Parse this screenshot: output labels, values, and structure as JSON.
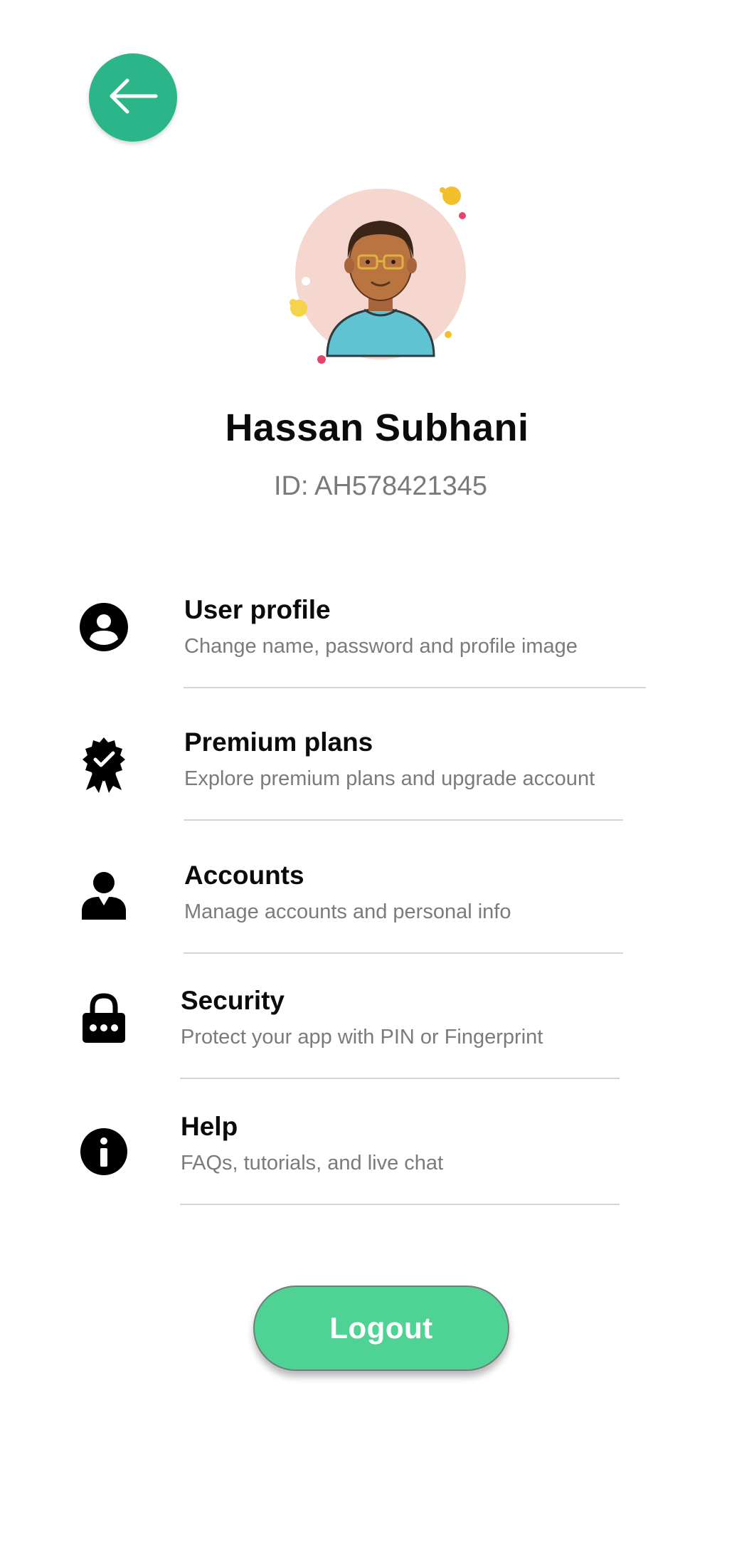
{
  "header": {
    "back_icon": "arrow-left-icon"
  },
  "profile": {
    "name": "Hassan Subhani",
    "id_text": "ID: AH578421345",
    "avatar_icon": "avatar-illustration"
  },
  "menu": {
    "items": [
      {
        "key": "user-profile",
        "icon": "user-circle-icon",
        "title": "User profile",
        "subtitle": "Change name, password and profile image"
      },
      {
        "key": "premium-plans",
        "icon": "verified-badge-icon",
        "title": "Premium plans",
        "subtitle": "Explore premium plans and upgrade account"
      },
      {
        "key": "accounts",
        "icon": "person-icon",
        "title": "Accounts",
        "subtitle": "Manage accounts and personal info"
      },
      {
        "key": "security",
        "icon": "lock-icon",
        "title": "Security",
        "subtitle": "Protect your app with PIN or Fingerprint"
      },
      {
        "key": "help",
        "icon": "info-icon",
        "title": "Help",
        "subtitle": "FAQs, tutorials, and live chat"
      }
    ]
  },
  "logout": {
    "label": "Logout"
  },
  "colors": {
    "accent": "#2bb589",
    "logout_bg": "#4fd394",
    "subtitle": "#7b7b7b",
    "divider": "#d5d5d5"
  }
}
